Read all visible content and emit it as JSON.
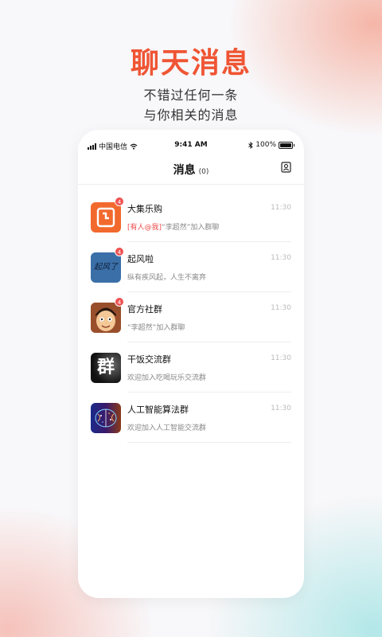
{
  "promo": {
    "title": "聊天消息",
    "subtitle_line1": "不错过任何一条",
    "subtitle_line2": "与你相关的消息"
  },
  "status_bar": {
    "carrier": "中国电信",
    "time": "9:41 AM",
    "battery": "100%"
  },
  "nav": {
    "title": "消息",
    "count": "(0)",
    "contacts_icon": "contacts-icon"
  },
  "chats": [
    {
      "name": "大集乐购",
      "time": "11:30",
      "badge": "4",
      "mention": "[有人@我]",
      "preview": "“李超然”加入群聊",
      "avatar": "orange-document-icon",
      "avatar_color": "#f2692e"
    },
    {
      "name": "起风啦",
      "time": "11:30",
      "badge": "4",
      "mention": "",
      "preview": "纵有疾风起，人生不离弃",
      "avatar": "起风了",
      "avatar_color": "#3b6fa8"
    },
    {
      "name": "官方社群",
      "time": "11:30",
      "badge": "4",
      "mention": "",
      "preview": "“李超然”加入群聊",
      "avatar": "cartoon-face-avatar",
      "avatar_color": "#b8653a"
    },
    {
      "name": "干饭交流群",
      "time": "11:30",
      "badge": "",
      "mention": "",
      "preview": "欢迎加入吃喝玩乐交流群",
      "avatar": "群",
      "avatar_color": "#1a1a1a"
    },
    {
      "name": "人工智能算法群",
      "time": "11:30",
      "badge": "",
      "mention": "",
      "preview": "欢迎加入人工智能交流群",
      "avatar": "brain-circuit-avatar",
      "avatar_color": "#1a2a6a"
    }
  ]
}
